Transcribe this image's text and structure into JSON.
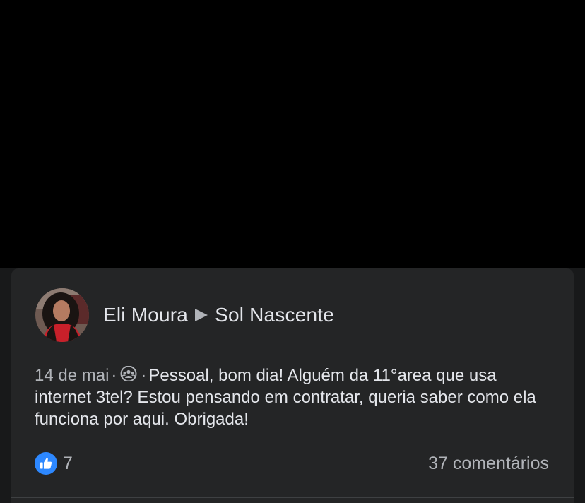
{
  "post": {
    "author": "Eli Moura",
    "group": "Sol Nascente",
    "date": "14 de mai",
    "separator": "·",
    "text": "Pessoal, bom dia! Alguém da 11°area que usa internet 3tel? Estou pensando em contratar, queria saber como ela funciona por aqui. Obrigada!",
    "privacy_icon": "group-icon",
    "reactions": {
      "icon": "like-icon",
      "count": "7",
      "color": "#2d88ff"
    },
    "comments": "37 comentários"
  },
  "colors": {
    "card_background": "#242526",
    "primary_text": "#e4e6eb",
    "secondary_text": "#b0b3b8"
  }
}
